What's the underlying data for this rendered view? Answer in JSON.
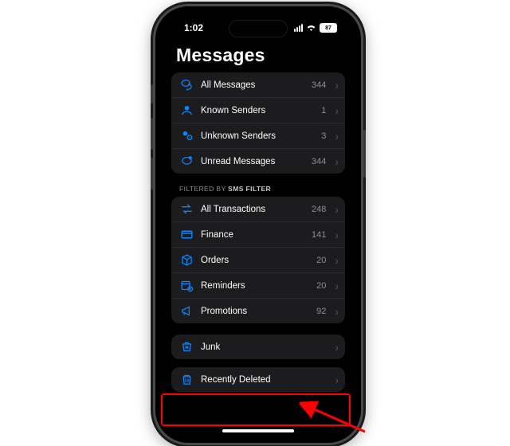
{
  "status": {
    "time": "1:02",
    "battery": "87"
  },
  "title": "Messages",
  "groups": {
    "main": [
      {
        "id": "all-messages",
        "label": "All Messages",
        "count": "344"
      },
      {
        "id": "known-senders",
        "label": "Known Senders",
        "count": "1"
      },
      {
        "id": "unknown-senders",
        "label": "Unknown Senders",
        "count": "3"
      },
      {
        "id": "unread-messages",
        "label": "Unread Messages",
        "count": "344"
      }
    ],
    "filter_label_a": "Filtered by ",
    "filter_label_b": "SMS Filter",
    "filtered": [
      {
        "id": "all-transactions",
        "label": "All Transactions",
        "count": "248"
      },
      {
        "id": "finance",
        "label": "Finance",
        "count": "141"
      },
      {
        "id": "orders",
        "label": "Orders",
        "count": "20"
      },
      {
        "id": "reminders",
        "label": "Reminders",
        "count": "20"
      },
      {
        "id": "promotions",
        "label": "Promotions",
        "count": "92"
      }
    ],
    "junk": {
      "label": "Junk"
    },
    "deleted": {
      "label": "Recently Deleted"
    }
  }
}
